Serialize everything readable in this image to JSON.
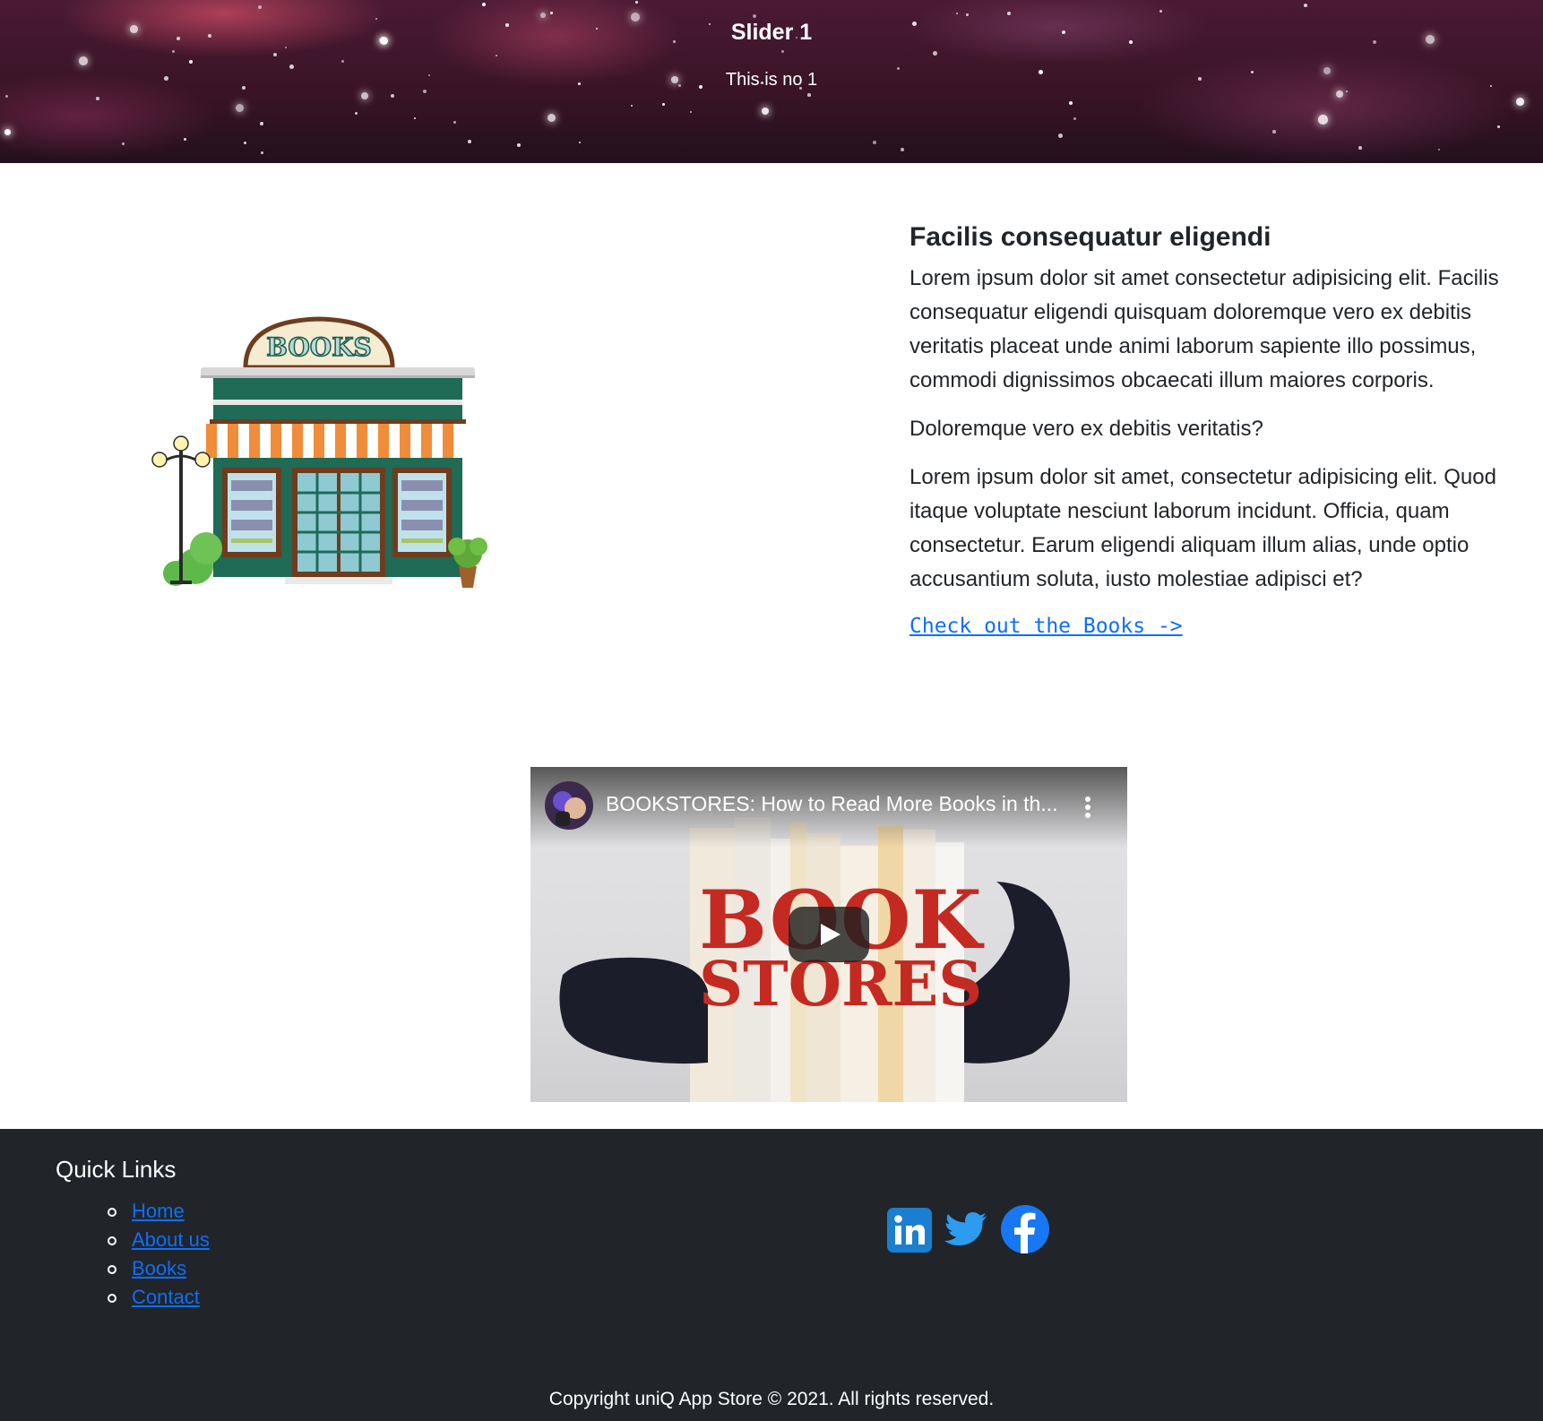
{
  "hero": {
    "title": "Slider 1",
    "subtitle": "This is no 1"
  },
  "feature": {
    "image_icon": "bookstore-illustration",
    "sign_text": "BOOKS",
    "title": "Facilis consequatur eligendi",
    "paragraph1": "Lorem ipsum dolor sit amet consectetur adipisicing elit. Facilis consequatur eligendi quisquam doloremque vero ex debitis veritatis placeat unde animi laborum sapiente illo possimus, commodi dignissimos obcaecati illum maiores corporis.",
    "question": "Doloremque vero ex debitis veritatis?",
    "paragraph2": "Lorem ipsum dolor sit amet, consectetur adipisicing elit. Quod itaque voluptate nesciunt laborum incidunt. Officia, quam consectetur. Earum eligendi aliquam illum alias, unde optio accusantium soluta, iusto molestiae adipisci et?",
    "link_label": "Check out the Books ->"
  },
  "video": {
    "title": "BOOKSTORES: How to Read More Books in th...",
    "thumb_line1": "BOOK",
    "thumb_line2": "STORES",
    "play_icon": "play-icon",
    "menu_icon": "more-vert-icon"
  },
  "footer": {
    "quick_links_title": "Quick Links",
    "links": [
      "Home",
      "About us",
      "Books",
      "Contact"
    ],
    "social_icons": [
      "linkedin-icon",
      "twitter-icon",
      "facebook-icon"
    ],
    "copyright": "Copyright uniQ App Store © 2021. All rights reserved."
  },
  "colors": {
    "link": "#0d6efd",
    "footer_bg": "#212529",
    "thumb_text": "#c42a22",
    "linkedin": "#1a7fd0",
    "twitter": "#2d9bf0",
    "facebook": "#1877f2"
  }
}
